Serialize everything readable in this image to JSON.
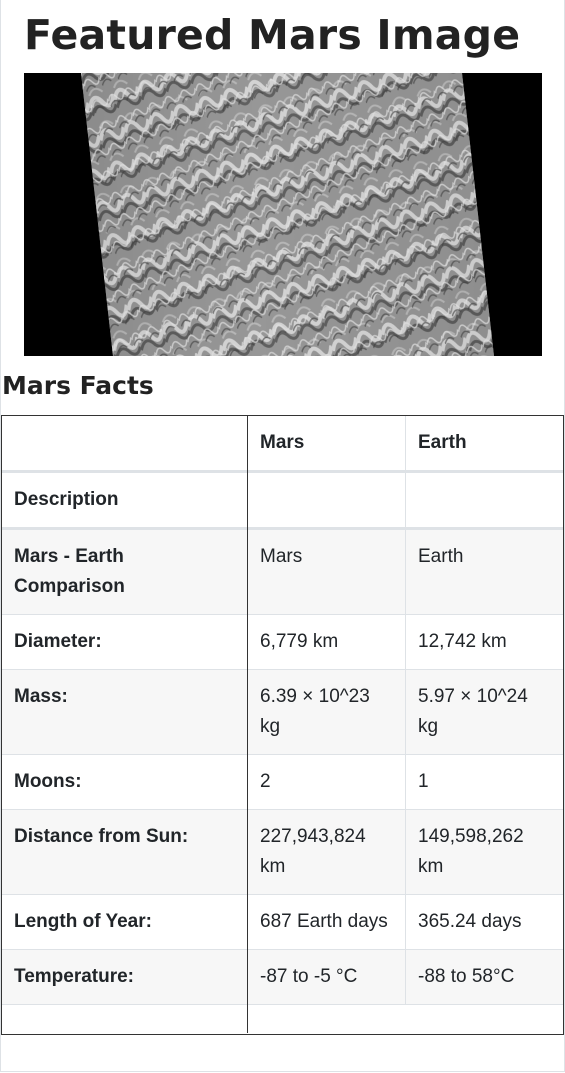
{
  "featured": {
    "title": "Featured Mars Image"
  },
  "facts": {
    "title": "Mars Facts",
    "headers": [
      "",
      "Mars",
      "Earth"
    ],
    "rows": [
      {
        "label": "Description",
        "mars": "",
        "earth": ""
      },
      {
        "label": "Mars - Earth Comparison",
        "mars": "Mars",
        "earth": "Earth"
      },
      {
        "label": "Diameter:",
        "mars": "6,779 km",
        "earth": "12,742 km"
      },
      {
        "label": "Mass:",
        "mars": "6.39 × 10^23 kg",
        "earth": "5.97 × 10^24 kg"
      },
      {
        "label": "Moons:",
        "mars": "2",
        "earth": "1"
      },
      {
        "label": "Distance from Sun:",
        "mars": "227,943,824 km",
        "earth": "149,598,262 km"
      },
      {
        "label": "Length of Year:",
        "mars": "687 Earth days",
        "earth": "365.24 days"
      },
      {
        "label": "Temperature:",
        "mars": "-87 to -5 °C",
        "earth": "-88 to 58°C"
      }
    ]
  }
}
